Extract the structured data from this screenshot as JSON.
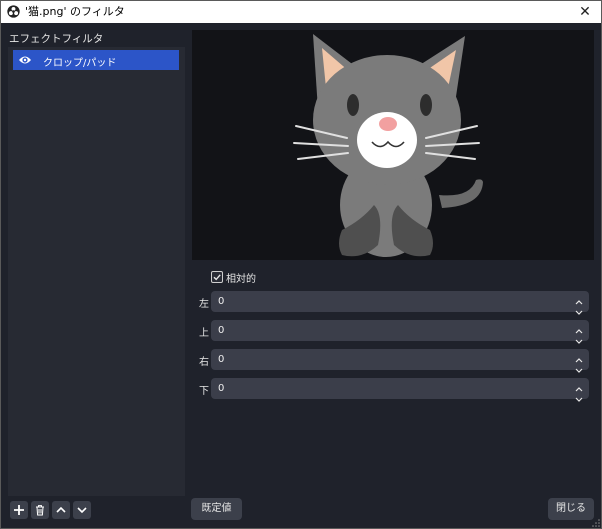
{
  "window": {
    "title": "'猫.png' のフィルタ",
    "close_glyph": "✕"
  },
  "effects": {
    "section_label": "エフェクトフィルタ",
    "items": [
      {
        "label": "クロップ/パッド",
        "icon": "eye-icon"
      }
    ]
  },
  "toolbar": {
    "icons": [
      "plus-icon",
      "trash-icon",
      "arrow-up-icon",
      "arrow-down-icon"
    ]
  },
  "settings": {
    "relative_label": "相対的",
    "relative_checked": true,
    "fields": [
      {
        "label": "左",
        "value": "0"
      },
      {
        "label": "上",
        "value": "0"
      },
      {
        "label": "右",
        "value": "0"
      },
      {
        "label": "下",
        "value": "0"
      }
    ]
  },
  "buttons": {
    "defaults": "既定値",
    "close": "閉じる"
  },
  "colors": {
    "accent": "#2c55c8",
    "background": "#1f222b",
    "panel": "#272a33",
    "preview_bg": "#121317"
  }
}
